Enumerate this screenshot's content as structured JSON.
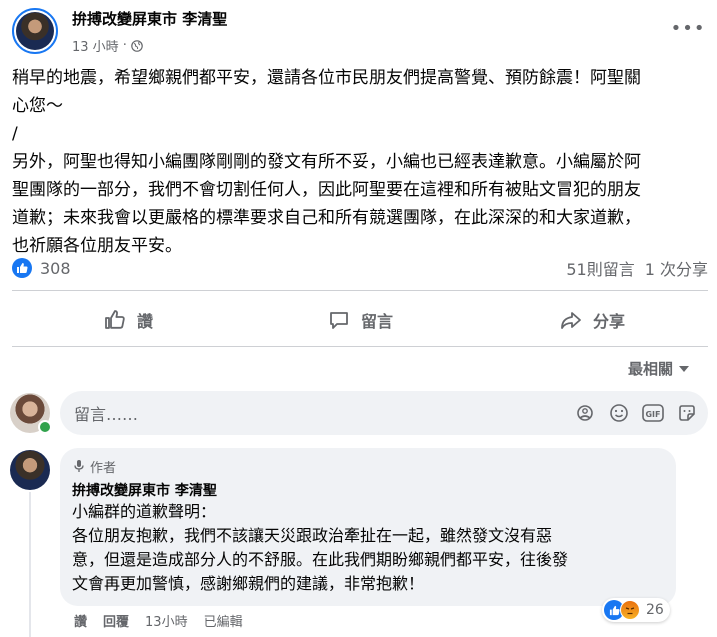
{
  "post": {
    "page_name": "拚搏改變屏東市 李清聖",
    "time": "13 小時",
    "text_lines": [
      "稍早的地震，希望鄉親們都平安，還請各位市民朋友們提高警覺、預防餘震！阿聖關",
      "心您～",
      "/",
      "另外，阿聖也得知小編團隊剛剛的發文有所不妥，小編也已經表達歉意。小編屬於阿",
      "聖團隊的一部分，我們不會切割任何人，因此阿聖要在這裡和所有被貼文冒犯的朋友",
      "道歉；未來我會以更嚴格的標準要求自己和所有競選團隊，在此深深的和大家道歉，",
      "也祈願各位朋友平安。"
    ]
  },
  "stats": {
    "likes": "308",
    "comments": "51則留言",
    "shares": "1 次分享"
  },
  "actions": {
    "like": "讚",
    "comment": "留言",
    "share": "分享"
  },
  "sort_label": "最相關",
  "comment_input": {
    "placeholder": "留言……"
  },
  "comment": {
    "badge": "作者",
    "author": "拚搏改變屏東市 李清聖",
    "text_lines": [
      "小編群的道歉聲明：",
      "各位朋友抱歉，我們不該讓天災跟政治牽扯在一起，雖然發文沒有惡",
      "意，但還是造成部分人的不舒服。在此我們期盼鄉親們都平安，往後發",
      "文會再更加警慎，感謝鄉親們的建議，非常抱歉！"
    ],
    "like": "讚",
    "reply": "回覆",
    "time": "13小時",
    "edited": "已編輯",
    "reaction_count": "26"
  },
  "colors": {
    "accent": "#1877f2",
    "muted": "#65676b",
    "bubble": "#f0f2f5"
  }
}
